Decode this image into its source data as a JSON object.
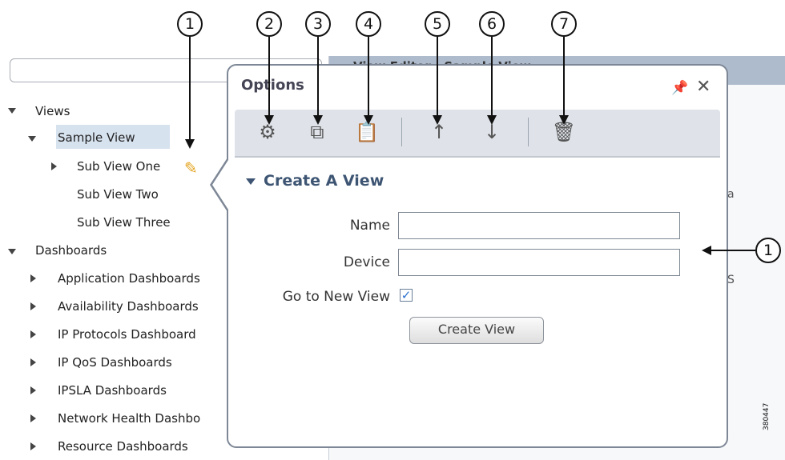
{
  "background_panel": {
    "title": "View Editor - Sample View",
    "right_text_1": "a",
    "right_text_2": "S"
  },
  "tree": {
    "items": [
      {
        "label": "Views"
      },
      {
        "label": "Sample View"
      },
      {
        "label": "Sub View One"
      },
      {
        "label": "Sub View Two"
      },
      {
        "label": "Sub View Three"
      },
      {
        "label": "Dashboards"
      },
      {
        "label": "Application Dashboards"
      },
      {
        "label": "Availability Dashboards"
      },
      {
        "label": "IP Protocols Dashboard"
      },
      {
        "label": "IP QoS Dashboards"
      },
      {
        "label": "IPSLA Dashboards"
      },
      {
        "label": "Network Health Dashbo"
      },
      {
        "label": "Resource Dashboards"
      }
    ]
  },
  "options_popup": {
    "title": "Options",
    "icons": {
      "pin": "pin-icon",
      "close": "close-icon"
    },
    "toolbar": [
      {
        "name": "add-view-icon",
        "glyph": "⚙"
      },
      {
        "name": "copy-icon",
        "glyph": "⧉"
      },
      {
        "name": "paste-icon",
        "glyph": "📋"
      },
      {
        "name": "move-up-icon",
        "glyph": "↑"
      },
      {
        "name": "move-down-icon",
        "glyph": "↓"
      },
      {
        "name": "delete-icon",
        "glyph": "🗑"
      }
    ],
    "section_title": "Create A View",
    "fields": {
      "name_label": "Name",
      "name_value": "",
      "device_label": "Device",
      "device_value": "",
      "go_to_new_view_label": "Go to New View",
      "go_to_new_view_checked": true
    },
    "create_button": "Create View"
  },
  "callouts": [
    "1",
    "2",
    "3",
    "4",
    "5",
    "6",
    "7",
    "1"
  ],
  "figure_id": "380447",
  "colors": {
    "accent": "#3d5573",
    "selection": "#d7e2ef",
    "border": "#7d8796",
    "pencil": "#e3a21a"
  }
}
